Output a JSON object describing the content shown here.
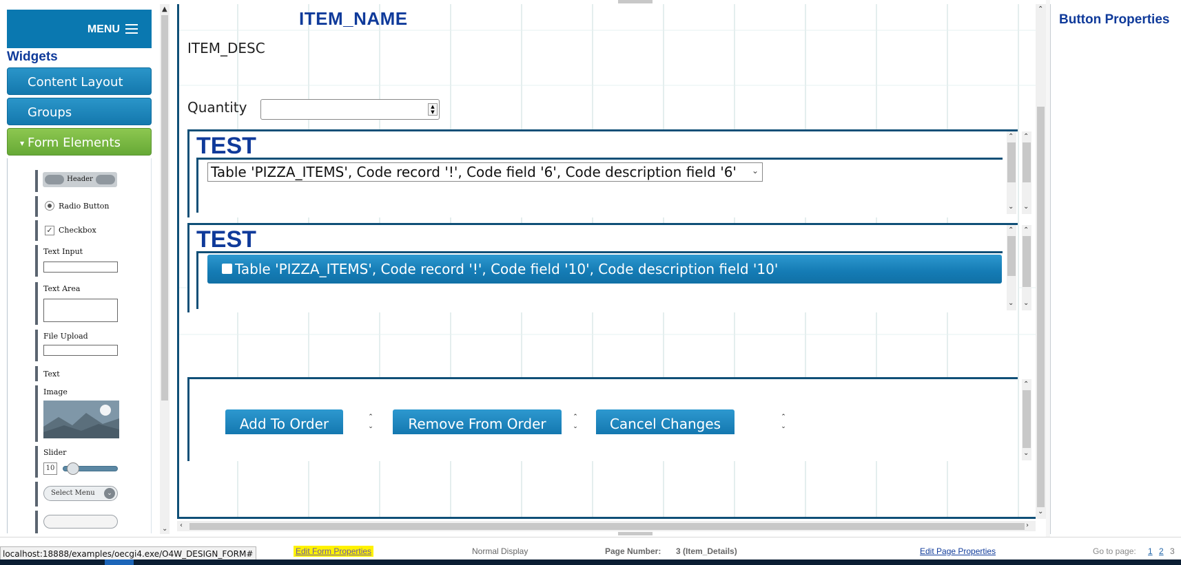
{
  "left_panel": {
    "menu_label": "MENU",
    "widgets_title": "Widgets",
    "accordions": [
      {
        "label": "Content Layout",
        "state": "collapsed"
      },
      {
        "label": "Groups",
        "state": "collapsed"
      },
      {
        "label": "Form Elements",
        "state": "expanded"
      }
    ],
    "widgets": {
      "header": "Header",
      "radio": "Radio Button",
      "checkbox": "Checkbox",
      "text_input": "Text Input",
      "text_area": "Text Area",
      "file_upload": "File Upload",
      "text": "Text",
      "image": "Image",
      "slider": "Slider",
      "slider_value": "10",
      "select_menu": "Select Menu"
    }
  },
  "canvas": {
    "item_name": "ITEM_NAME",
    "item_desc": "ITEM_DESC",
    "quantity_label": "Quantity",
    "quantity_value": "",
    "groups": [
      {
        "title": "TEST",
        "control": "Table 'PIZZA_ITEMS', Code record '!', Code field '6', Code description field '6'"
      },
      {
        "title": "TEST",
        "control": "Table 'PIZZA_ITEMS', Code record '!', Code field '10', Code description field '10'"
      }
    ],
    "buttons": [
      "Add To Order",
      "Remove From Order",
      "Cancel Changes"
    ]
  },
  "right_panel": {
    "title": "Button Properties"
  },
  "footer": {
    "status_url": "localhost:18888/examples/oecgi4.exe/O4W_DESIGN_FORM#",
    "edit_form": "Edit Form Properties",
    "normal_display": "Normal Display",
    "page_number_label": "Page Number:",
    "page_number_value": "3 (Item_Details)",
    "edit_page": "Edit Page Properties",
    "goto_label": "Go to page:",
    "pages": [
      "1",
      "2",
      "3"
    ]
  },
  "colors": {
    "accent_blue": "#0a78b0",
    "title_blue": "#0f3a9a",
    "accordion_green": "#66a936",
    "highlight_yellow": "#fff200"
  }
}
